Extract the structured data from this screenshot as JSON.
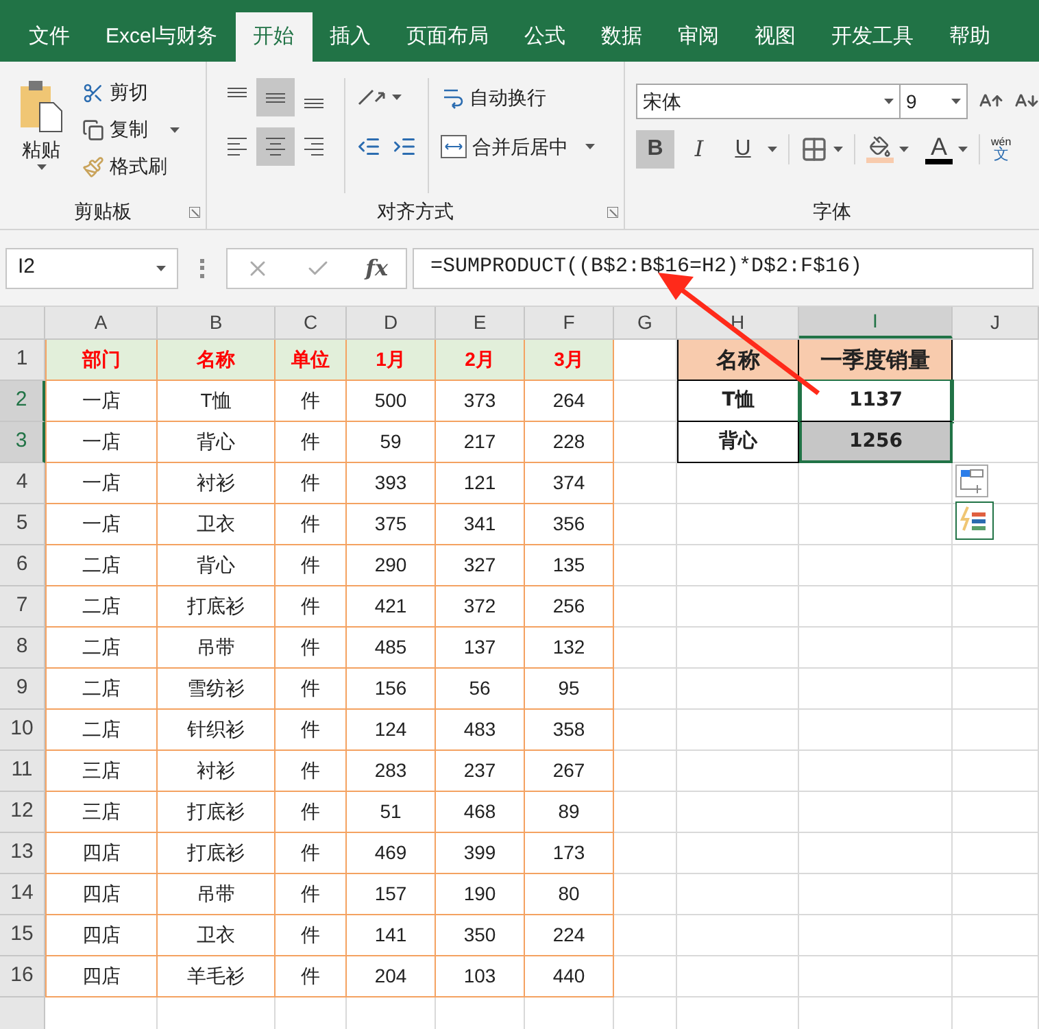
{
  "tabs": [
    {
      "label": "文件",
      "selected": false
    },
    {
      "label": "Excel与财务",
      "selected": false
    },
    {
      "label": "开始",
      "selected": true
    },
    {
      "label": "插入",
      "selected": false
    },
    {
      "label": "页面布局",
      "selected": false
    },
    {
      "label": "公式",
      "selected": false
    },
    {
      "label": "数据",
      "selected": false
    },
    {
      "label": "审阅",
      "selected": false
    },
    {
      "label": "视图",
      "selected": false
    },
    {
      "label": "开发工具",
      "selected": false
    },
    {
      "label": "帮助",
      "selected": false
    }
  ],
  "ribbon": {
    "clipboard": {
      "paste": "粘贴",
      "cut": "剪切",
      "copy": "复制",
      "format_painter": "格式刷",
      "group_label": "剪贴板"
    },
    "alignment": {
      "vertical_align": [
        {
          "kind": "top",
          "selected": false
        },
        {
          "kind": "middle",
          "selected": true
        },
        {
          "kind": "bottom",
          "selected": false
        }
      ],
      "horizontal_align": [
        {
          "kind": "left",
          "selected": false
        },
        {
          "kind": "center",
          "selected": true
        },
        {
          "kind": "right",
          "selected": false
        }
      ],
      "wrap_text": "自动换行",
      "merge_center": "合并后居中",
      "group_label": "对齐方式"
    },
    "font": {
      "font_name": "宋体",
      "font_size": "9",
      "style_buttons": [
        {
          "label": "B",
          "kind": "bold",
          "selected": true
        },
        {
          "label": "I",
          "kind": "italic",
          "selected": false
        },
        {
          "label": "U",
          "kind": "underline",
          "selected": false
        }
      ],
      "font_color_letter": "A",
      "phonetic": {
        "top": "wén",
        "bottom": "文"
      },
      "group_label": "字体"
    }
  },
  "formula_bar": {
    "name_box": "I2",
    "fx": "fx",
    "formula": "=SUMPRODUCT((B$2:B$16=H2)*D$2:F$16)"
  },
  "columns": [
    {
      "label": "A",
      "selected": false
    },
    {
      "label": "B",
      "selected": false
    },
    {
      "label": "C",
      "selected": false
    },
    {
      "label": "D",
      "selected": false
    },
    {
      "label": "E",
      "selected": false
    },
    {
      "label": "F",
      "selected": false
    },
    {
      "label": "G",
      "selected": false
    },
    {
      "label": "H",
      "selected": false
    },
    {
      "label": "I",
      "selected": true
    },
    {
      "label": "J",
      "selected": false
    }
  ],
  "row_numbers": [
    {
      "label": "1",
      "selected": false
    },
    {
      "label": "2",
      "selected": true
    },
    {
      "label": "3",
      "selected": true
    },
    {
      "label": "4",
      "selected": false
    },
    {
      "label": "5",
      "selected": false
    },
    {
      "label": "6",
      "selected": false
    },
    {
      "label": "7",
      "selected": false
    },
    {
      "label": "8",
      "selected": false
    },
    {
      "label": "9",
      "selected": false
    },
    {
      "label": "10",
      "selected": false
    },
    {
      "label": "11",
      "selected": false
    },
    {
      "label": "12",
      "selected": false
    },
    {
      "label": "13",
      "selected": false
    },
    {
      "label": "14",
      "selected": false
    },
    {
      "label": "15",
      "selected": false
    },
    {
      "label": "16",
      "selected": false
    }
  ],
  "sales_table": {
    "header": [
      "部门",
      "名称",
      "单位",
      "1月",
      "2月",
      "3月"
    ],
    "rows": [
      [
        "一店",
        "T恤",
        "件",
        "500",
        "373",
        "264"
      ],
      [
        "一店",
        "背心",
        "件",
        "59",
        "217",
        "228"
      ],
      [
        "一店",
        "衬衫",
        "件",
        "393",
        "121",
        "374"
      ],
      [
        "一店",
        "卫衣",
        "件",
        "375",
        "341",
        "356"
      ],
      [
        "二店",
        "背心",
        "件",
        "290",
        "327",
        "135"
      ],
      [
        "二店",
        "打底衫",
        "件",
        "421",
        "372",
        "256"
      ],
      [
        "二店",
        "吊带",
        "件",
        "485",
        "137",
        "132"
      ],
      [
        "二店",
        "雪纺衫",
        "件",
        "156",
        "56",
        "95"
      ],
      [
        "二店",
        "针织衫",
        "件",
        "124",
        "483",
        "358"
      ],
      [
        "三店",
        "衬衫",
        "件",
        "283",
        "237",
        "267"
      ],
      [
        "三店",
        "打底衫",
        "件",
        "51",
        "468",
        "89"
      ],
      [
        "四店",
        "打底衫",
        "件",
        "469",
        "399",
        "173"
      ],
      [
        "四店",
        "吊带",
        "件",
        "157",
        "190",
        "80"
      ],
      [
        "四店",
        "卫衣",
        "件",
        "141",
        "350",
        "224"
      ],
      [
        "四店",
        "羊毛衫",
        "件",
        "204",
        "103",
        "440"
      ]
    ]
  },
  "summary_table": {
    "header": [
      "名称",
      "一季度销量"
    ],
    "rows": [
      {
        "name": "T恤",
        "total": "1137",
        "active": true,
        "selected": true
      },
      {
        "name": "背心",
        "total": "1256",
        "active": false,
        "selected": true
      }
    ]
  }
}
